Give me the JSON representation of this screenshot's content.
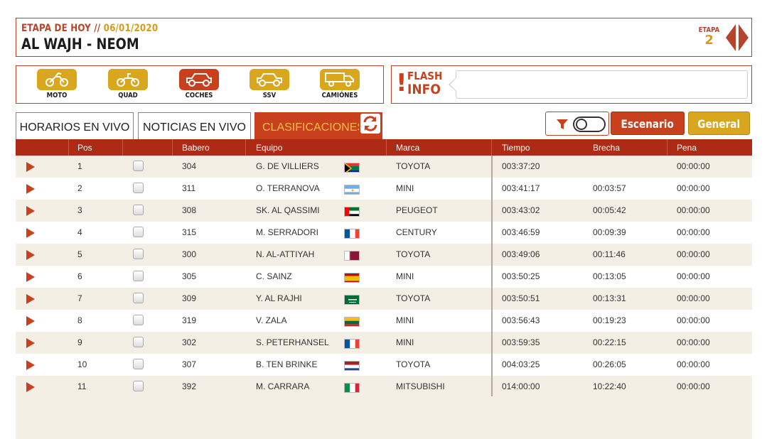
{
  "header": {
    "stage_label": "ETAPA DE HOY //",
    "stage_date": "06/01/2020",
    "route": "AL WAJH - NEOM",
    "etapa_label": "ETAPA",
    "etapa_number": "2"
  },
  "vehicles": [
    {
      "label": "MOTO",
      "icon": "motorcycle-icon",
      "active": false
    },
    {
      "label": "QUAD",
      "icon": "quad-icon",
      "active": false
    },
    {
      "label": "COCHES",
      "icon": "car-icon",
      "active": true
    },
    {
      "label": "SSV",
      "icon": "ssv-icon",
      "active": false
    },
    {
      "label": "CAMIÓNES",
      "icon": "truck-icon",
      "active": false
    }
  ],
  "flash": {
    "line1": "FLASH",
    "line2": "INFO",
    "message": ""
  },
  "tabs": {
    "horarios": "HORARIOS EN VIVO",
    "noticias": "NOTICIAS EN VIVO",
    "clasificaciones": "CLASIFICACIONES"
  },
  "buttons": {
    "escenario": "Escenario",
    "general": "General"
  },
  "colors": {
    "brand_red": "#c9401e",
    "brand_gold": "#d8a71d",
    "header_row": "#ad2b15"
  },
  "table": {
    "columns": [
      "Pos",
      "Babero",
      "Equipo",
      "Marca",
      "Tiempo",
      "Brecha",
      "Pena"
    ],
    "rows": [
      {
        "pos": "1",
        "bib": "304",
        "team": "G. DE VILLIERS",
        "flag": "south-africa",
        "brand": "TOYOTA",
        "time": "003:37:20",
        "gap": "",
        "penalty": "00:00:00"
      },
      {
        "pos": "2",
        "bib": "311",
        "team": "O. TERRANOVA",
        "flag": "argentina",
        "brand": "MINI",
        "time": "003:41:17",
        "gap": "00:03:57",
        "penalty": "00:00:00"
      },
      {
        "pos": "3",
        "bib": "308",
        "team": "SK. AL QASSIMI",
        "flag": "uae",
        "brand": "PEUGEOT",
        "time": "003:43:02",
        "gap": "00:05:42",
        "penalty": "00:00:00"
      },
      {
        "pos": "4",
        "bib": "315",
        "team": "M. SERRADORI",
        "flag": "france",
        "brand": "CENTURY",
        "time": "003:46:59",
        "gap": "00:09:39",
        "penalty": "00:00:00"
      },
      {
        "pos": "5",
        "bib": "300",
        "team": "N. AL-ATTIYAH",
        "flag": "qatar",
        "brand": "TOYOTA",
        "time": "003:49:06",
        "gap": "00:11:46",
        "penalty": "00:00:00"
      },
      {
        "pos": "6",
        "bib": "305",
        "team": "C. SAINZ",
        "flag": "spain",
        "brand": "MINI",
        "time": "003:50:25",
        "gap": "00:13:05",
        "penalty": "00:00:00"
      },
      {
        "pos": "7",
        "bib": "309",
        "team": "Y. AL RAJHI",
        "flag": "saudi-arabia",
        "brand": "TOYOTA",
        "time": "003:50:51",
        "gap": "00:13:31",
        "penalty": "00:00:00"
      },
      {
        "pos": "8",
        "bib": "319",
        "team": "V. ZALA",
        "flag": "lithuania",
        "brand": "MINI",
        "time": "003:56:43",
        "gap": "00:19:23",
        "penalty": "00:00:00"
      },
      {
        "pos": "9",
        "bib": "302",
        "team": "S. PETERHANSEL",
        "flag": "france",
        "brand": "MINI",
        "time": "003:59:35",
        "gap": "00:22:15",
        "penalty": "00:00:00"
      },
      {
        "pos": "10",
        "bib": "307",
        "team": "B. TEN BRINKE",
        "flag": "netherlands",
        "brand": "TOYOTA",
        "time": "004:03:25",
        "gap": "00:26:05",
        "penalty": "00:00:00"
      },
      {
        "pos": "11",
        "bib": "392",
        "team": "M. CARRARA",
        "flag": "italy",
        "brand": "MITSUBISHI",
        "time": "014:00:00",
        "gap": "10:22:40",
        "penalty": "00:00:00"
      }
    ]
  }
}
